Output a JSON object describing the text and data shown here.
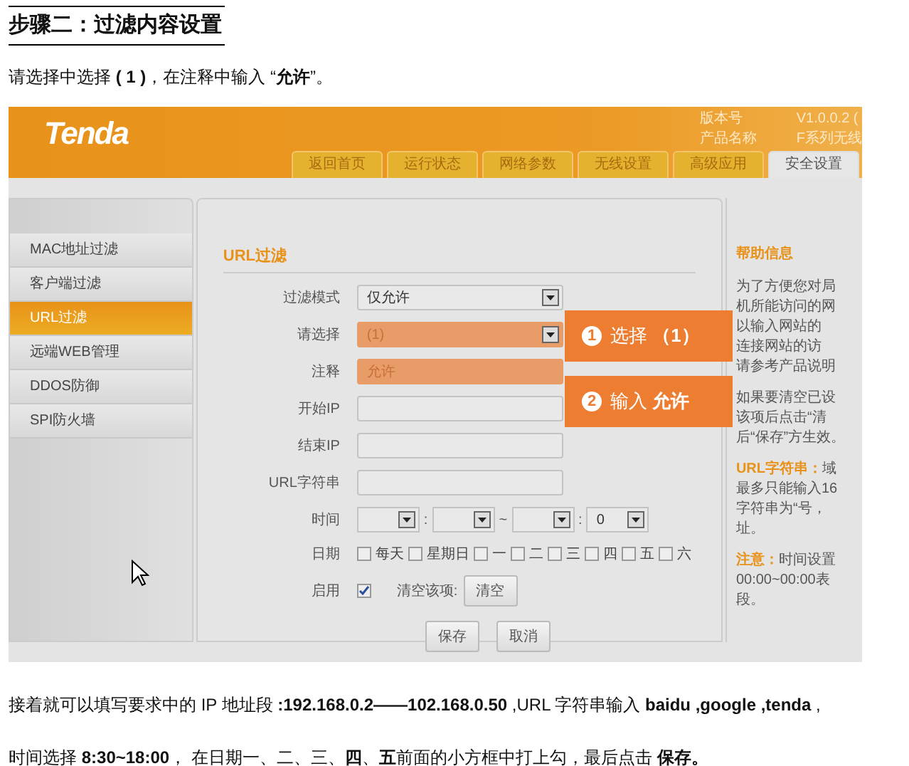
{
  "heading": "步骤二：过滤内容设置",
  "instruction": "请选择中选择 **( 1 )**，在注释中输入 “**允许**”。",
  "router": {
    "logo": "Tenda",
    "version_label": "版本号",
    "version": "V1.0.0.2 (",
    "product_label": "产品名称",
    "product": "F系列无线",
    "tabs": [
      {
        "label": "返回首页",
        "selected": false
      },
      {
        "label": "运行状态",
        "selected": false
      },
      {
        "label": "网络参数",
        "selected": false
      },
      {
        "label": "无线设置",
        "selected": false
      },
      {
        "label": "高级应用",
        "selected": false
      },
      {
        "label": "安全设置",
        "selected": true
      }
    ],
    "sidebar": [
      {
        "label": "MAC地址过滤",
        "selected": false
      },
      {
        "label": "客户端过滤",
        "selected": false
      },
      {
        "label": "URL过滤",
        "selected": true
      },
      {
        "label": "远端WEB管理",
        "selected": false
      },
      {
        "label": "DDOS防御",
        "selected": false
      },
      {
        "label": "SPI防火墙",
        "selected": false
      }
    ],
    "panel_title": "URL过滤",
    "form": [
      {
        "kind": "select",
        "label": "过滤模式",
        "value": "仅允许",
        "highlighted": false
      },
      {
        "kind": "select",
        "label": "请选择",
        "value": "(1)",
        "highlighted": true
      },
      {
        "kind": "text",
        "label": "注释",
        "value": "允许",
        "highlighted": true
      },
      {
        "kind": "text",
        "label": "开始IP",
        "highlighted": false
      },
      {
        "kind": "text",
        "label": "结束IP",
        "highlighted": false
      },
      {
        "kind": "text",
        "label": "URL字符串",
        "highlighted": false
      },
      {
        "kind": "time",
        "label": "时间",
        "parts": [
          {
            "kind": "select"
          },
          {
            "kind": "sep",
            "text": ":"
          },
          {
            "kind": "select"
          },
          {
            "kind": "sep",
            "text": "~"
          },
          {
            "kind": "select"
          },
          {
            "kind": "sep",
            "text": ":"
          },
          {
            "kind": "select",
            "value": "0"
          }
        ]
      },
      {
        "kind": "days",
        "label": "日期",
        "days": [
          {
            "label": "每天",
            "checked": false
          },
          {
            "label": "星期日",
            "checked": false
          },
          {
            "label": "一",
            "checked": false
          },
          {
            "label": "二",
            "checked": false
          },
          {
            "label": "三",
            "checked": false
          },
          {
            "label": "四",
            "checked": false
          },
          {
            "label": "五",
            "checked": false
          },
          {
            "label": "六",
            "checked": false
          }
        ]
      },
      {
        "kind": "enable",
        "label": "启用",
        "checked": true,
        "clear_label": "清空该项:",
        "clear_button": "清空"
      }
    ],
    "buttons": [
      "保存",
      "取消"
    ],
    "help": {
      "title": "帮助信息",
      "blocks": [
        {
          "lines": [
            {
              "text": "为了方便您对局"
            },
            {
              "text": "机所能访问的网"
            },
            {
              "text": "以输入网站的"
            },
            {
              "text": "连接网站的访"
            },
            {
              "text": "请参考产品说明"
            }
          ]
        },
        {
          "lines": [
            {
              "text": "如果要清空已设"
            },
            {
              "text": "该项后点击“清"
            },
            {
              "text": "后“保存”方生效。"
            }
          ]
        },
        {
          "term": "URL字符串：",
          "lines": [
            {
              "text": "域"
            },
            {
              "text": "最多只能输入16"
            },
            {
              "text": "字符串为“号，"
            },
            {
              "text": "址。"
            }
          ]
        },
        {
          "term": "注意：",
          "lines": [
            {
              "text": "时间设置"
            },
            {
              "text": "00:00~00:00表"
            },
            {
              "text": "段。"
            }
          ]
        }
      ]
    },
    "callouts": [
      {
        "number": "1",
        "text": "选择 **（1）**"
      },
      {
        "number": "2",
        "text": "输入 **允许**"
      }
    ]
  },
  "bottom": [
    "接着就可以填写要求中的 IP 地址段 **:192.168.0.2——102.168.0.50** ,URL 字符串输入 **baidu ,google ,tenda** ,",
    "时间选择 **8:30~18:00**， 在日期一、二、三、**四**、**五**前面的小方框中打上勾，最后点击 **保存。**"
  ]
}
